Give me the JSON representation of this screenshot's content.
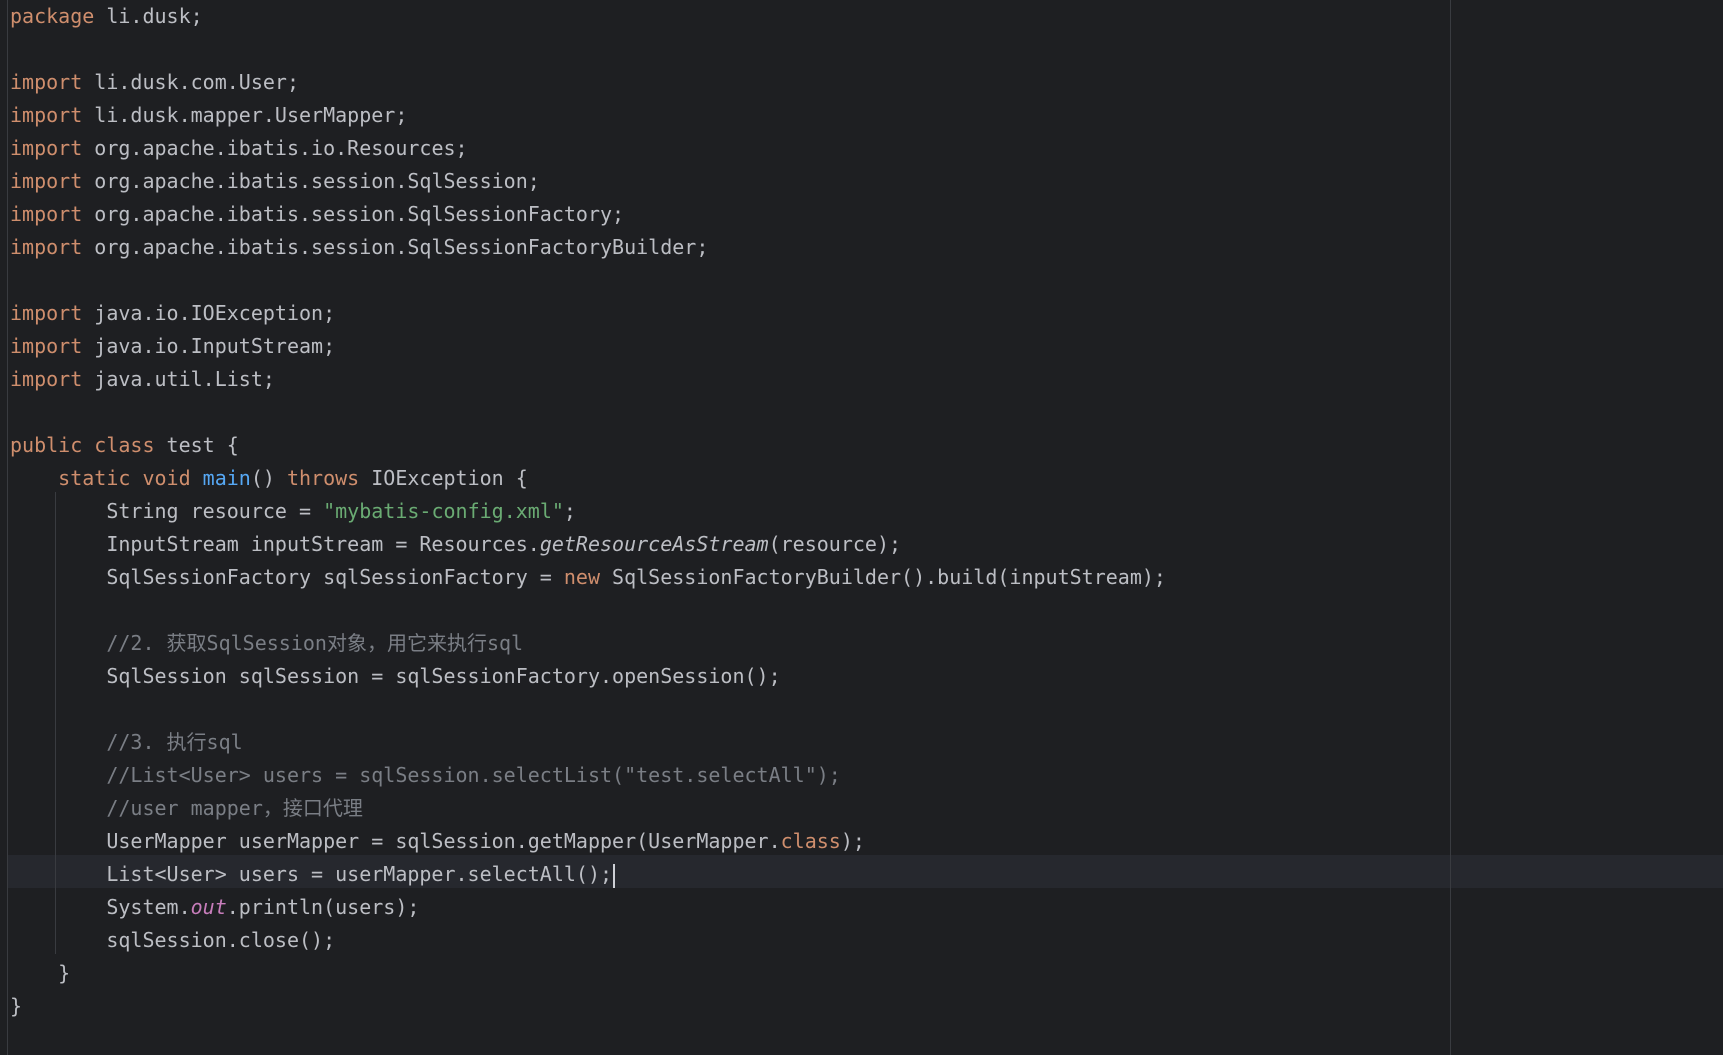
{
  "editor": {
    "language": "java",
    "caret_line": 27,
    "colors": {
      "background": "#1e1f22",
      "text": "#bcbec4",
      "keyword": "#cf8e6d",
      "string": "#6aab73",
      "method_decl": "#56a8f5",
      "comment": "#7a7e85",
      "static_field": "#c77dbb",
      "current_line": "#26282e"
    },
    "lines": [
      [
        {
          "t": "package",
          "c": "kw"
        },
        {
          "t": " li.dusk;"
        }
      ],
      [],
      [
        {
          "t": "import",
          "c": "kw"
        },
        {
          "t": " li.dusk.com.User;"
        }
      ],
      [
        {
          "t": "import",
          "c": "kw"
        },
        {
          "t": " li.dusk.mapper.UserMapper;"
        }
      ],
      [
        {
          "t": "import",
          "c": "kw"
        },
        {
          "t": " org.apache.ibatis.io.Resources;"
        }
      ],
      [
        {
          "t": "import",
          "c": "kw"
        },
        {
          "t": " org.apache.ibatis.session.SqlSession;"
        }
      ],
      [
        {
          "t": "import",
          "c": "kw"
        },
        {
          "t": " org.apache.ibatis.session.SqlSessionFactory;"
        }
      ],
      [
        {
          "t": "import",
          "c": "kw"
        },
        {
          "t": " org.apache.ibatis.session.SqlSessionFactoryBuilder;"
        }
      ],
      [],
      [
        {
          "t": "import",
          "c": "kw"
        },
        {
          "t": " java.io.IOException;"
        }
      ],
      [
        {
          "t": "import",
          "c": "kw"
        },
        {
          "t": " java.io.InputStream;"
        }
      ],
      [
        {
          "t": "import",
          "c": "kw"
        },
        {
          "t": " java.util.List;"
        }
      ],
      [],
      [
        {
          "t": "public class",
          "c": "kw"
        },
        {
          "t": " test {"
        }
      ],
      [
        {
          "t": "    "
        },
        {
          "t": "static void",
          "c": "kw"
        },
        {
          "t": " "
        },
        {
          "t": "main",
          "c": "fn"
        },
        {
          "t": "() "
        },
        {
          "t": "throws",
          "c": "kw"
        },
        {
          "t": " IOException {"
        }
      ],
      [
        {
          "t": "        String resource = "
        },
        {
          "t": "\"mybatis-config.xml\"",
          "c": "str"
        },
        {
          "t": ";"
        }
      ],
      [
        {
          "t": "        InputStream inputStream = Resources."
        },
        {
          "t": "getResourceAsStream",
          "c": "it"
        },
        {
          "t": "(resource);"
        }
      ],
      [
        {
          "t": "        SqlSessionFactory sqlSessionFactory = "
        },
        {
          "t": "new",
          "c": "kw"
        },
        {
          "t": " SqlSessionFactoryBuilder().build(inputStream);"
        }
      ],
      [],
      [
        {
          "t": "        "
        },
        {
          "t": "//2. 获取SqlSession对象，用它来执行sql",
          "c": "cm"
        }
      ],
      [
        {
          "t": "        SqlSession sqlSession = sqlSessionFactory.openSession();"
        }
      ],
      [],
      [
        {
          "t": "        "
        },
        {
          "t": "//3. 执行sql",
          "c": "cm"
        }
      ],
      [
        {
          "t": "        "
        },
        {
          "t": "//List<User> users = sqlSession.selectList(\"test.selectAll\");",
          "c": "cm"
        }
      ],
      [
        {
          "t": "        "
        },
        {
          "t": "//user mapper，接口代理",
          "c": "cm"
        }
      ],
      [
        {
          "t": "        UserMapper userMapper = sqlSession.getMapper(UserMapper."
        },
        {
          "t": "class",
          "c": "kw"
        },
        {
          "t": ");"
        }
      ],
      [
        {
          "t": "        List<User> users = userMapper.selectAll();"
        }
      ],
      [
        {
          "t": "        System."
        },
        {
          "t": "out",
          "c": "sf"
        },
        {
          "t": ".println(users);"
        }
      ],
      [
        {
          "t": "        sqlSession.close();"
        }
      ],
      [
        {
          "t": "    }"
        }
      ],
      [
        {
          "t": "}"
        }
      ]
    ]
  }
}
